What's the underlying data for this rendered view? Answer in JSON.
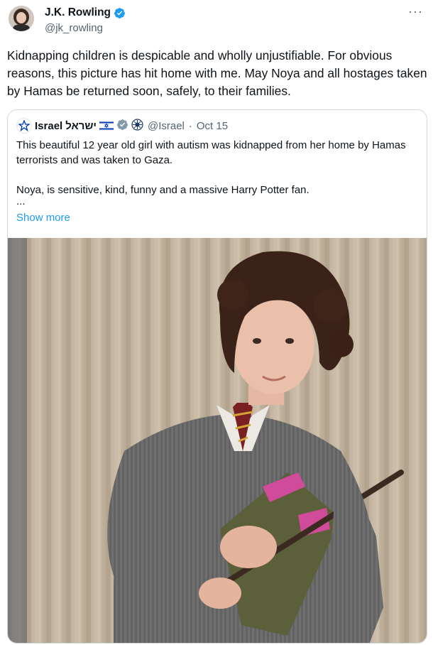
{
  "author": {
    "display_name": "J.K. Rowling",
    "handle": "@jk_rowling",
    "verified": true,
    "avatar_icon": "profile-photo"
  },
  "more_label": "···",
  "tweet_text": "Kidnapping children is despicable and wholly unjustifiable. For obvious reasons, this picture has hit home with me. May Noya and all hostages taken by Hamas be returned soon, safely, to their families.",
  "quoted": {
    "display_name": "Israel",
    "hebrew_name": "ישראל",
    "handle": "@Israel",
    "separator": "·",
    "date": "Oct 15",
    "badges": [
      "israel-flag-icon",
      "verified-gray-icon",
      "government-seal-icon"
    ],
    "text_line1": "This beautiful 12 year old girl with autism was kidnapped from her home by Hamas terrorists and was taken to Gaza.",
    "text_line2": "Noya, is sensitive, kind, funny and a massive Harry Potter fan.",
    "ellipsis": "...",
    "show_more": "Show more"
  },
  "colors": {
    "link": "#1d9bf0",
    "secondary": "#536471",
    "verified_blue": "#1d9bf0",
    "border": "#cfd9de"
  }
}
